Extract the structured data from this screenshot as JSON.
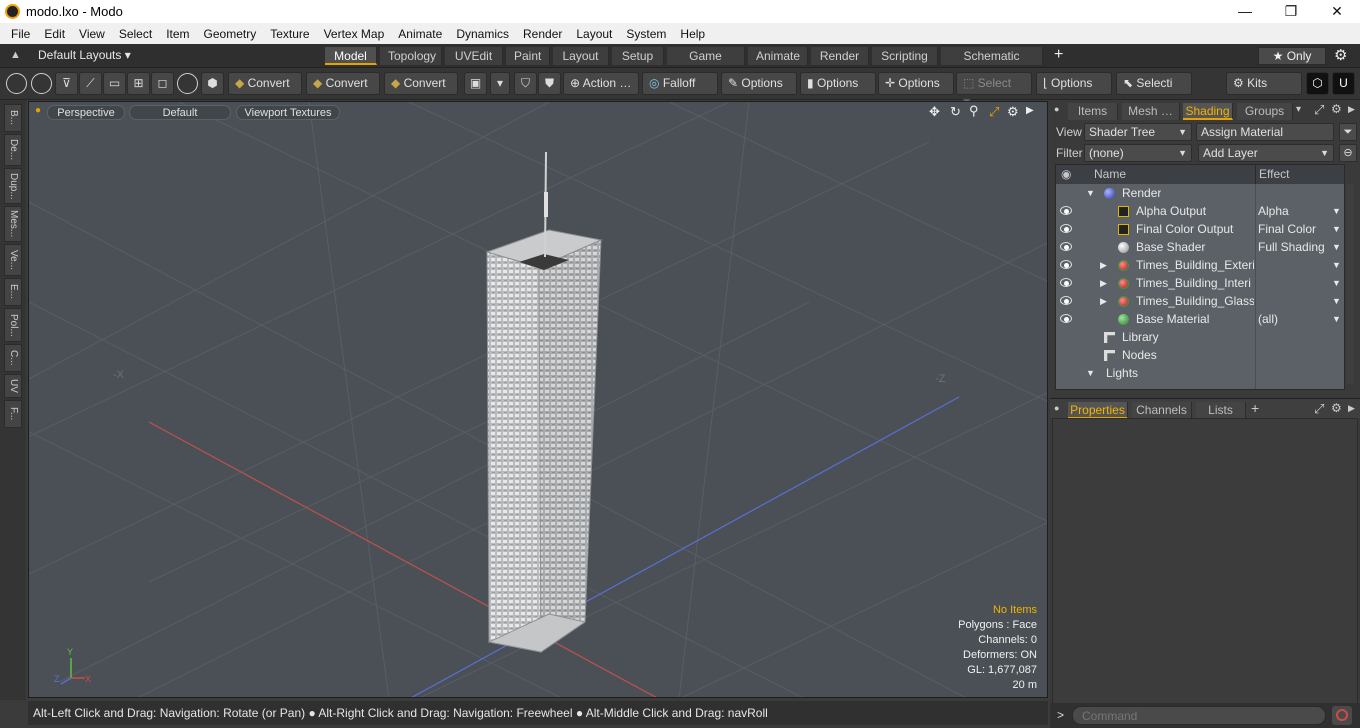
{
  "window": {
    "title": "modo.lxo - Modo",
    "min": "—",
    "max": "❐",
    "close": "✕"
  },
  "menu": [
    "File",
    "Edit",
    "View",
    "Select",
    "Item",
    "Geometry",
    "Texture",
    "Vertex Map",
    "Animate",
    "Dynamics",
    "Render",
    "Layout",
    "System",
    "Help"
  ],
  "layouts": {
    "label": "Default Layouts ▾",
    "tabs": [
      "Model",
      "Topology",
      "UVEdit",
      "Paint",
      "Layout",
      "Setup",
      "Game Tools",
      "Animate",
      "Render",
      "Scripting",
      "Schematic Fusion"
    ],
    "active": "Model",
    "add": "+",
    "only": "★  Only",
    "gear": "⚙"
  },
  "toolbar": {
    "convert1": "Convert",
    "convert2": "Convert",
    "convert3": "Convert",
    "action": "Action  …",
    "falloff": "Falloff",
    "options1": "Options",
    "options2": "Options",
    "options3": "Options",
    "select_t": "Select T…",
    "options4": "Options",
    "selecti": "Selecti …",
    "kits": "Kits"
  },
  "lefttabs": [
    "B...",
    "De...",
    "Dup...",
    "Mes...",
    "Ve...",
    "E...",
    "Pol...",
    "C...",
    "UV",
    "F..."
  ],
  "viewport": {
    "perspective": "Perspective",
    "default": "Default",
    "textures": "Viewport Textures",
    "axis_x": "-X",
    "axis_z": "-Z",
    "hud": {
      "items": "No Items",
      "polygons": "Polygons : Face",
      "channels": "Channels: 0",
      "deformers": "Deformers: ON",
      "gl": "GL: 1,677,087",
      "scale": "20 m"
    }
  },
  "status": "Alt-Left Click and Drag: Navigation: Rotate (or Pan) ● Alt-Right Click and Drag: Navigation: Freewheel ● Alt-Middle Click and Drag: navRoll",
  "panel": {
    "tabs": [
      "Items",
      "Mesh …",
      "Shading",
      "Groups"
    ],
    "active": "Shading",
    "view_label": "View",
    "view_value": "Shader Tree",
    "assign": "Assign Material",
    "filter_label": "Filter",
    "filter_value": "(none)",
    "add_layer": "Add Layer",
    "col_name": "Name",
    "col_effect": "Effect",
    "rows": [
      {
        "name": "Render",
        "effect": ""
      },
      {
        "name": "Alpha Output",
        "effect": "Alpha"
      },
      {
        "name": "Final Color Output",
        "effect": "Final Color"
      },
      {
        "name": "Base Shader",
        "effect": "Full Shading"
      },
      {
        "name": "Times_Building_Exteri…",
        "effect": ""
      },
      {
        "name": "Times_Building_Interi …",
        "effect": ""
      },
      {
        "name": "Times_Building_Glass …",
        "effect": ""
      },
      {
        "name": "Base Material",
        "effect": "(all)"
      },
      {
        "name": "Library",
        "effect": ""
      },
      {
        "name": "Nodes",
        "effect": ""
      },
      {
        "name": "Lights",
        "effect": ""
      }
    ],
    "bottom_tabs": [
      "Properties",
      "Channels",
      "Lists"
    ],
    "bottom_active": "Properties",
    "command_placeholder": "Command"
  },
  "colors": {
    "accent": "#e8a200",
    "viewport": "#4a5055"
  }
}
